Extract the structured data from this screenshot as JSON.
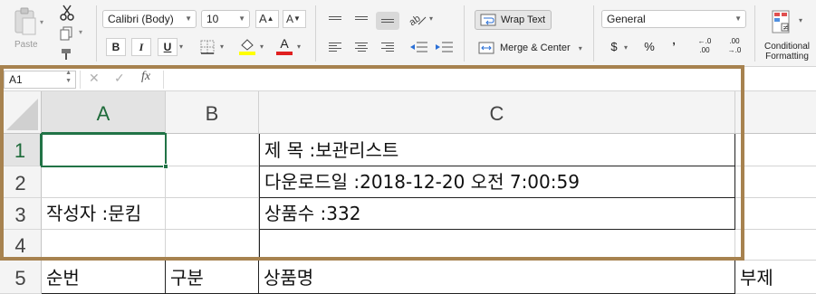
{
  "ribbon": {
    "clipboard": {
      "paste_label": "Paste"
    },
    "font": {
      "family": "Calibri (Body)",
      "size": "10",
      "grow_label": "A",
      "shrink_label": "A",
      "bold": "B",
      "italic": "I",
      "underline": "U",
      "font_color_letter": "A"
    },
    "alignment": {
      "wrap_text_label": "Wrap Text",
      "merge_center_label": "Merge & Center"
    },
    "number": {
      "format": "General",
      "currency": "$",
      "percent": "%",
      "comma": "ʼ",
      "increase_decimal": "←.0\n.00",
      "decrease_decimal": ".00\n→.0"
    },
    "styles": {
      "conditional_formatting_label": "Conditional\nFormatting"
    },
    "colors": {
      "highlight": "#ffff00",
      "font_color": "#e02020",
      "accent": "#217346"
    }
  },
  "formula_bar": {
    "name_box": "A1",
    "cancel_icon": "✕",
    "enter_icon": "✓",
    "fx_label": "fx",
    "formula": ""
  },
  "grid": {
    "columns": [
      "A",
      "B",
      "C"
    ],
    "rows": [
      {
        "header": "1",
        "cells": [
          "",
          "",
          "제 목 :보관리스트",
          ""
        ]
      },
      {
        "header": "2",
        "cells": [
          "",
          "",
          "다운로드일 :2018-12-20 오전 7:00:59",
          ""
        ]
      },
      {
        "header": "3",
        "cells": [
          "작성자 :문킴",
          "",
          "상품수 :332",
          ""
        ]
      },
      {
        "header": "4",
        "cells": [
          "",
          "",
          "",
          ""
        ]
      },
      {
        "header": "5",
        "cells": [
          "순번",
          "구분",
          "상품명",
          "부제"
        ]
      }
    ],
    "selected_cell": "A1"
  }
}
